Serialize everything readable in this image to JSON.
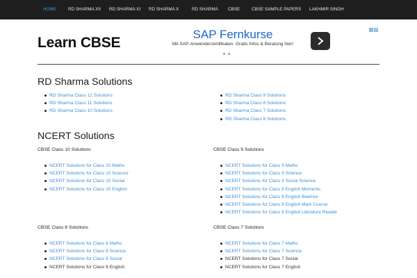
{
  "nav": {
    "items": [
      {
        "label": "HOME",
        "active": true
      },
      {
        "label": "RD SHARMA XII"
      },
      {
        "label": "RD SHARMA XI"
      },
      {
        "label": "RD SHARMA X"
      },
      {
        "label": "RD SHARMA"
      },
      {
        "label": "CBSE"
      },
      {
        "label": "CBSE SAMPLE PAPERS"
      },
      {
        "label": "LAKHMIR SINGH"
      }
    ]
  },
  "site": {
    "title": "Learn CBSE"
  },
  "ad": {
    "headline": "SAP Fernkurse",
    "body": "Mit SAP-Anwenderzertifikaten. Gratis Infos & Beratung hier!"
  },
  "rd_sharma": {
    "title": "RD Sharma Solutions",
    "left": [
      "RD Sharma Class 12 Solutions",
      "RD Sharma Class 11 Solutions",
      "RD Sharma Class 10 Solutions"
    ],
    "right": [
      "RD Sharma Class 9 Solutions",
      "RD Sharma Class 8 Solutions",
      "RD Sharma Class 7 Solutions",
      "RD Sharma Class 6 Solutions"
    ]
  },
  "ncert": {
    "title": "NCERT Solutions",
    "class10": {
      "title": "CBSE Class 10 Solutions",
      "items": [
        "NCERT Solutions for Class 10 Maths",
        "NCERT Solutions for Class 10 Science",
        "NCERT Solutions for Class 10 Social",
        "NCERT Solutions for Class 10 English"
      ]
    },
    "class9": {
      "title": "CBSE Class 9 Solutions",
      "items": [
        "NCERT Solutions for Class 9 Maths",
        "NCERT Solutions for Class 9 Science",
        "NCERT Solutions for Class 9 Social Science",
        "NCERT Solutions for Class 9 English Moments",
        "NCERT Solutions for Class 9 English Beehive",
        "NCERT Solutions for Class 9 English Main Course",
        "NCERT Solutions for Class 9 English  Literature Reader"
      ]
    },
    "class8": {
      "title": "CBSE Class 8 Solutions",
      "items": [
        "NCERT Solutions for Class 8 Maths",
        "NCERT Solutions for Class 8 Science",
        "NCERT Solutions for Class 8 Social",
        "NCERT Solutions for Class 8 English"
      ]
    },
    "class7": {
      "title": "CBSE Class 7 Solutions",
      "items": [
        "NCERT Solutions for Class 7 Maths",
        "NCERT Solutions for Class 7 Science",
        "NCERT Solutions for Class 7 Social",
        "NCERT Solutions for Class 7 English"
      ]
    }
  },
  "colors": {
    "link": "#3a8fd4",
    "nav_bg": "#1e1e1e",
    "nav_active": "#3f97d8",
    "ad_headline": "#1a66c9"
  }
}
